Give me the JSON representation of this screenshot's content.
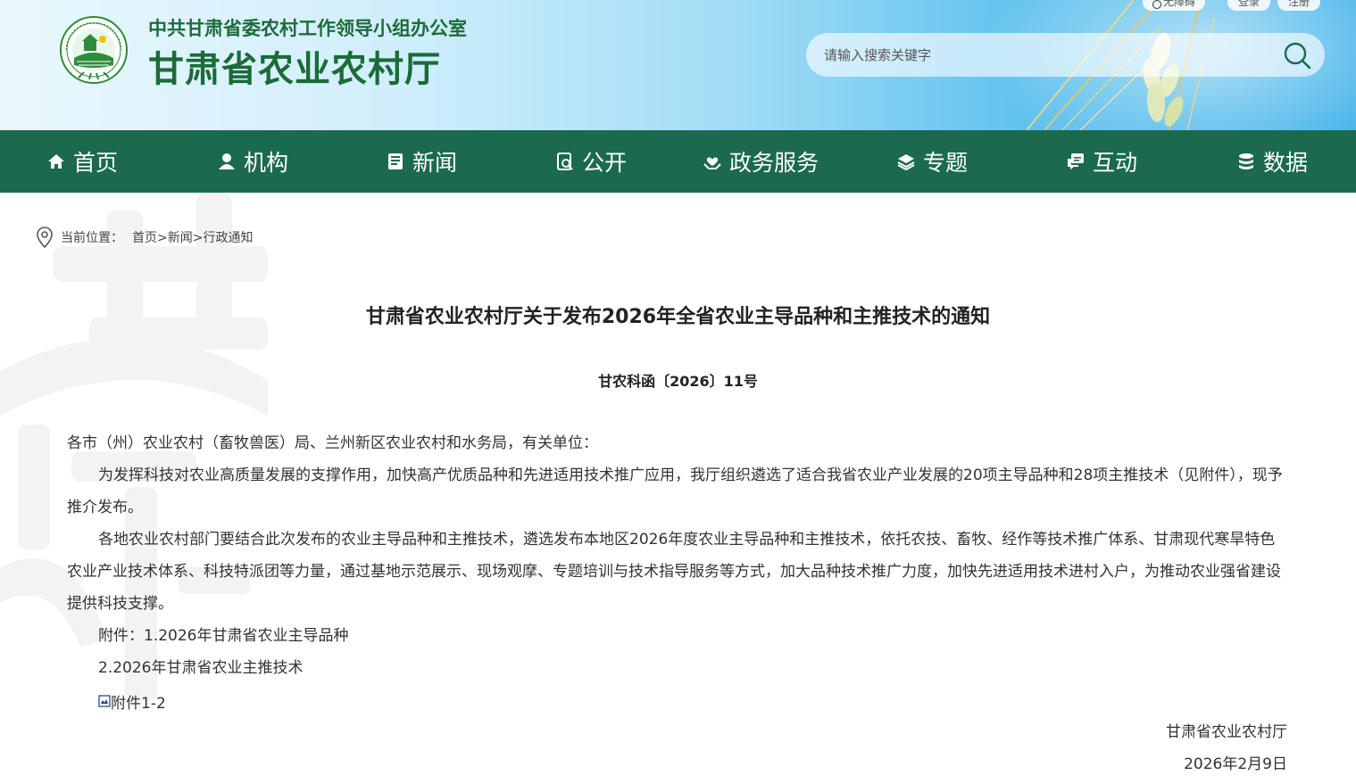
{
  "header": {
    "org_line": "中共甘肃省委农村工作领导小组办公室",
    "site_title": "甘肃省农业农村厅",
    "top_links": {
      "accessibility": "无障碍",
      "login": "登录",
      "register": "注册"
    },
    "search": {
      "placeholder": "请输入搜索关键字"
    },
    "colors": {
      "title_green": "#1a6b38",
      "nav_green": "#1b6a4e"
    }
  },
  "nav": {
    "items": [
      {
        "label": "首页",
        "icon": "home-icon"
      },
      {
        "label": "机构",
        "icon": "person-icon"
      },
      {
        "label": "新闻",
        "icon": "newspaper-icon"
      },
      {
        "label": "公开",
        "icon": "document-search-icon"
      },
      {
        "label": "政务服务",
        "icon": "heart-hand-icon"
      },
      {
        "label": "专题",
        "icon": "layers-icon"
      },
      {
        "label": "互动",
        "icon": "chat-icon"
      },
      {
        "label": "数据",
        "icon": "database-icon"
      }
    ]
  },
  "breadcrumb": {
    "label": "当前位置：",
    "items": [
      "首页",
      "新闻",
      "行政通知"
    ],
    "separator": ">"
  },
  "article": {
    "title": "甘肃省农业农村厅关于发布2026年全省农业主导品种和主推技术的通知",
    "doc_number": "甘农科函〔2026〕11号",
    "salutation": "各市（州）农业农村（畜牧兽医）局、兰州新区农业农村和水务局，有关单位：",
    "paragraph_1": "为发挥科技对农业高质量发展的支撑作用，加快高产优质品种和先进适用技术推广应用，我厅组织遴选了适合我省农业产业发展的20项主导品种和28项主推技术（见附件），现予推介发布。",
    "paragraph_2": "各地农业农村部门要结合此次发布的农业主导品种和主推技术，遴选发布本地区2026年度农业主导品种和主推技术，依托农技、畜牧、经作等技术推广体系、甘肃现代寒旱特色农业产业技术体系、科技特派团等力量，通过基地示范展示、现场观摩、专题培训与技术指导服务等方式，加大品种技术推广力度，加快先进适用技术进村入户，为推动农业强省建设提供科技支撑。",
    "attachment_1": "附件：1.2026年甘肃省农业主导品种",
    "attachment_2": "2.2026年甘肃省农业主推技术",
    "attachment_link": "附件1-2",
    "signature": "甘肃省农业农村厅",
    "date": "2026年2月9日"
  }
}
